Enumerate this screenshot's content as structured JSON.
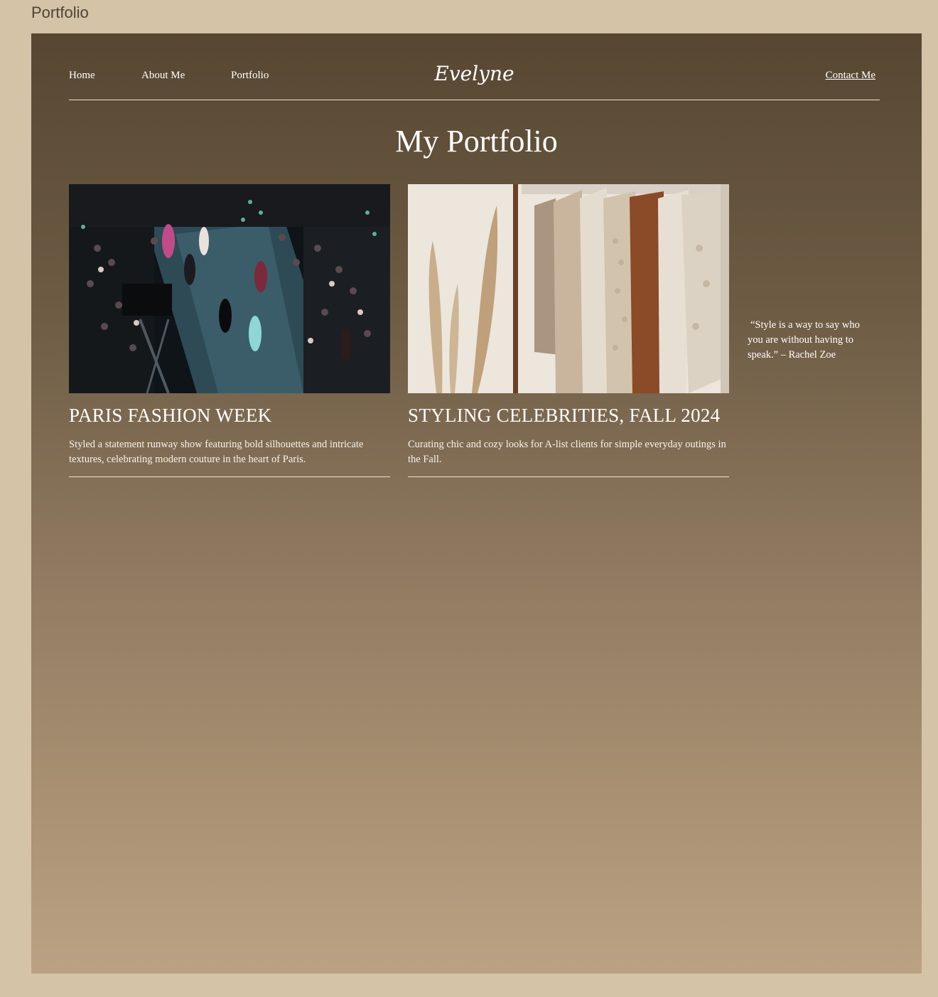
{
  "frame_label": "Portfolio",
  "nav": {
    "home": "Home",
    "about": "About Me",
    "portfolio": "Portfolio",
    "logo": "Evelyne",
    "contact": "Contact Me"
  },
  "page_title": "My Portfolio",
  "projects": [
    {
      "title": "PARIS FASHION WEEK",
      "description": "Styled a statement runway show featuring bold silhouettes and intricate textures, celebrating modern couture in the heart of Paris."
    },
    {
      "title": "STYLING CELEBRITIES, FALL 2024",
      "description": "Curating chic and cozy looks for A-list clients for simple everyday outings in the Fall."
    }
  ],
  "quote": "“Style is a way to say who you are without having to speak.” – Rachel Zoe"
}
